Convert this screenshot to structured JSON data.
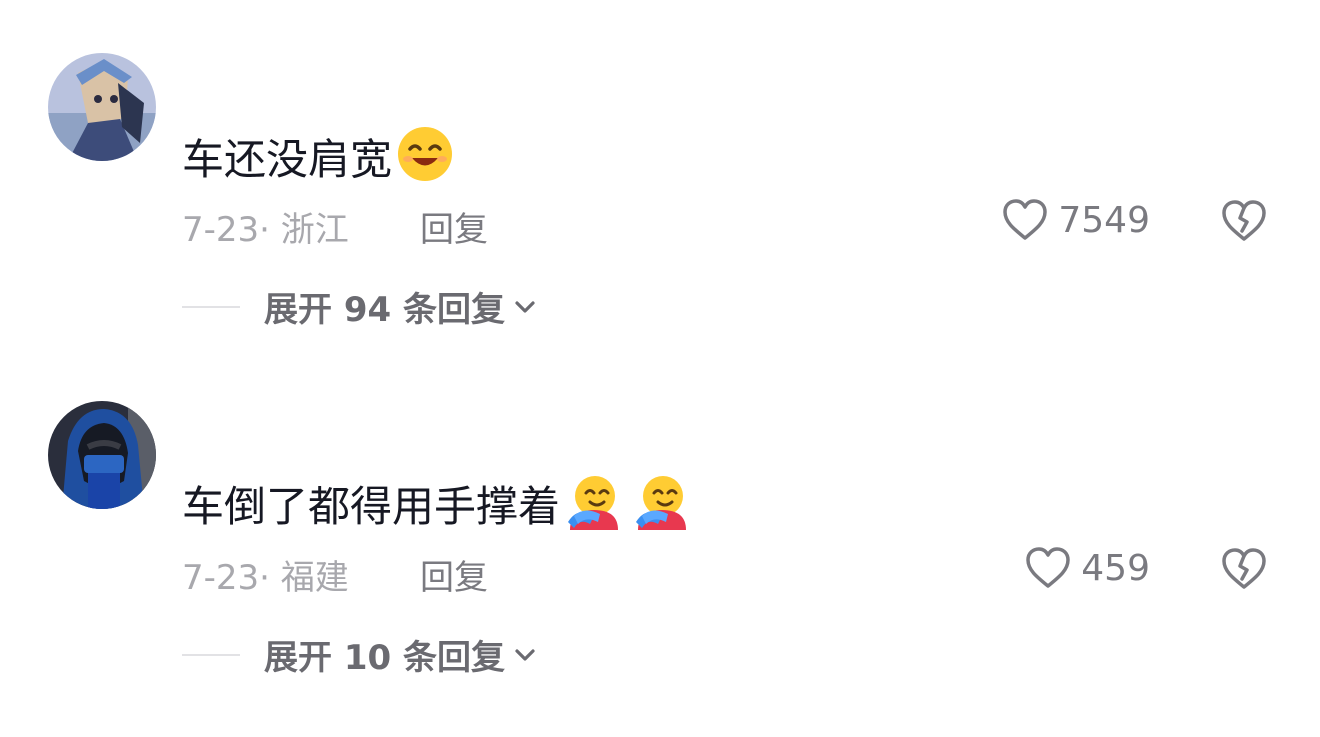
{
  "comments": [
    {
      "avatar_icon": "anime-character-avatar",
      "text": "车还没肩宽",
      "emojis": [
        "smiling-face-emoji"
      ],
      "date": "7-23·",
      "location": "浙江",
      "reply_label": "回复",
      "likes": "7549",
      "expand_label": "展开 94 条回复"
    },
    {
      "avatar_icon": "hooded-person-avatar",
      "text": "车倒了都得用手撑着",
      "emojis": [
        "hugging-face-emoji",
        "hugging-face-emoji"
      ],
      "date": "7-23·",
      "location": "福建",
      "reply_label": "回复",
      "likes": "459",
      "expand_label": "展开 10 条回复"
    }
  ],
  "colors": {
    "text": "#161823",
    "meta": "#a8a8ad",
    "action": "#7a7a80"
  }
}
